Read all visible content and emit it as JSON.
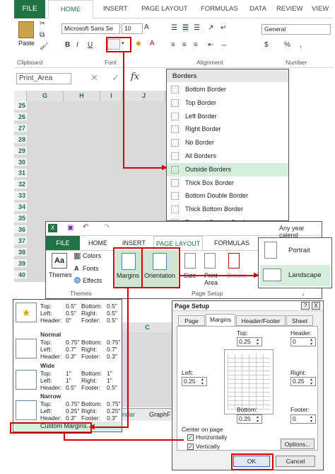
{
  "ribbon": {
    "tabs": [
      "FILE",
      "HOME",
      "INSERT",
      "PAGE LAYOUT",
      "FORMULAS",
      "DATA",
      "REVIEW",
      "VIEW"
    ],
    "paste_label": "Paste",
    "clipboard_label": "Clipboard",
    "font_name": "Microsoft Sans Se",
    "font_size": "10",
    "bold": "B",
    "italic": "I",
    "underline": "U",
    "font_label": "Font",
    "alignment_label": "Alignment",
    "number_format": "General",
    "currency": "$",
    "percent": "%",
    "comma": ",",
    "number_label": "Number"
  },
  "formula_bar": {
    "name_box": "Print_Area",
    "fx": "fx"
  },
  "grid": {
    "columns": [
      "G",
      "H",
      "I",
      "J"
    ],
    "rows": [
      "25",
      "26",
      "27",
      "28",
      "29",
      "30",
      "31",
      "32",
      "33",
      "34",
      "35",
      "36",
      "37",
      "38",
      "39",
      "40"
    ],
    "lower_column": "C"
  },
  "borders_menu": {
    "title": "Borders",
    "items": [
      "Bottom Border",
      "Top Border",
      "Left Border",
      "Right Border",
      "No Border",
      "All Borders",
      "Outside Borders",
      "Thick Box Border",
      "Bottom Double Border",
      "Thick Bottom Border",
      "Top and Bottom Border"
    ]
  },
  "page_layout": {
    "tabs": [
      "FILE",
      "HOME",
      "INSERT",
      "PAGE LAYOUT",
      "FORMULAS"
    ],
    "title_text": "Any year calend",
    "themes": "Themes",
    "colors": "Colors",
    "fonts": "Fonts",
    "effects": "Effects",
    "themes_group": "Themes",
    "margins": "Margins",
    "orientation": "Orientation",
    "size": "Size",
    "print_area": "Print Area",
    "breaks": "Breaks",
    "page_setup_group": "Page Setup"
  },
  "orientation_menu": {
    "portrait": "Portrait",
    "landscape": "Landscape"
  },
  "margins_menu": {
    "presets": [
      {
        "name": "",
        "top": "0.5\"",
        "bottom": "0.5\"",
        "left": "0.5\"",
        "right": "0.5\"",
        "header": "0\"",
        "footer": "0.5\""
      },
      {
        "name": "Normal",
        "top": "0.75\"",
        "bottom": "0.75\"",
        "left": "0.7\"",
        "right": "0.7\"",
        "header": "0.3\"",
        "footer": "0.3\""
      },
      {
        "name": "Wide",
        "top": "1\"",
        "bottom": "1\"",
        "left": "1\"",
        "right": "1\"",
        "header": "0.5\"",
        "footer": "0.5\""
      },
      {
        "name": "Narrow",
        "top": "0.75\"",
        "bottom": "0.75\"",
        "left": "0.25\"",
        "right": "0.25\"",
        "header": "0.3\"",
        "footer": "0.3\""
      }
    ],
    "custom": "Custom Margins..."
  },
  "sheet_tabs": {
    "tab1": "ndar",
    "tab2": "GraphF"
  },
  "page_setup": {
    "title": "Page Setup",
    "help": "?",
    "close": "X",
    "tabs": [
      "Page",
      "Margins",
      "Header/Footer",
      "Sheet"
    ],
    "top_label": "Top:",
    "top": "0.25",
    "header_label": "Header:",
    "header": "0",
    "left_label": "Left:",
    "left": "0.25",
    "right_label": "Right:",
    "right": "0.25",
    "bottom_label": "Bottom:",
    "bottom": "0.25",
    "footer_label": "Footer:",
    "footer": "0",
    "center_label": "Center on page",
    "horizontally": "Horizontally",
    "vertically": "Vertically",
    "options": "Options...",
    "ok": "OK",
    "cancel": "Cancel"
  },
  "colors": {
    "excel_green": "#217346",
    "highlight": "#d10000",
    "menu_hl": "#d5eddd"
  }
}
